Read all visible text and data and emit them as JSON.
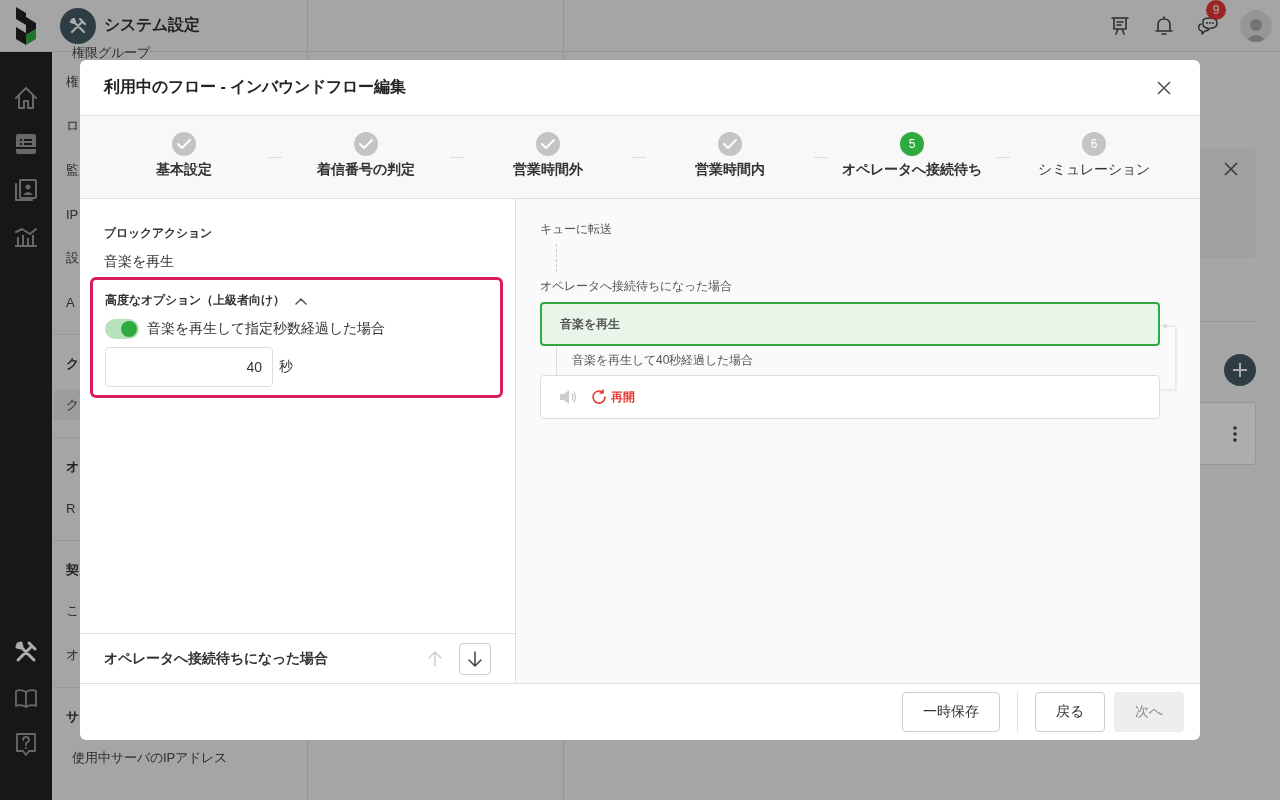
{
  "app": {
    "title": "システム設定"
  },
  "header_icons": [
    {
      "kind": "board"
    },
    {
      "kind": "bell"
    },
    {
      "kind": "chat",
      "badge": "9"
    }
  ],
  "rail": [
    {
      "kind": "home",
      "selected": false
    },
    {
      "kind": "list",
      "selected": false
    },
    {
      "kind": "contact",
      "selected": false
    },
    {
      "kind": "chart",
      "selected": false
    },
    {
      "kind": "spacer"
    },
    {
      "kind": "tools",
      "selected": true
    },
    {
      "kind": "book",
      "selected": false
    },
    {
      "kind": "help",
      "selected": false
    }
  ],
  "settings_menu": [
    {
      "kind": "item",
      "label": "権限グループ",
      "selected": false
    },
    {
      "kind": "item",
      "label": "権",
      "selected": false
    },
    {
      "kind": "item",
      "label": "ロ",
      "selected": false
    },
    {
      "kind": "item",
      "label": "監",
      "selected": false
    },
    {
      "kind": "item",
      "label": "IP",
      "selected": false
    },
    {
      "kind": "item",
      "label": "設",
      "selected": false
    },
    {
      "kind": "item",
      "label": "A",
      "selected": false
    },
    {
      "kind": "header",
      "label": "ク"
    },
    {
      "kind": "item",
      "label": "ク",
      "selected": true
    },
    {
      "kind": "header",
      "label": "オ"
    },
    {
      "kind": "item",
      "label": "R",
      "selected": false
    },
    {
      "kind": "header",
      "label": "契"
    },
    {
      "kind": "item",
      "label": "こ",
      "selected": false
    },
    {
      "kind": "item",
      "label": "オ",
      "selected": false
    },
    {
      "kind": "header",
      "label": "サ"
    },
    {
      "kind": "item",
      "label": "使用中サーバのIPアドレス",
      "selected": false
    }
  ],
  "dialog": {
    "title": "利用中のフロー - インバウンドフロー編集",
    "steps": [
      {
        "label": "基本設定",
        "completed": true,
        "selected": false
      },
      {
        "label": "着信番号の判定",
        "completed": true,
        "selected": false
      },
      {
        "label": "営業時間外",
        "completed": true,
        "selected": false
      },
      {
        "label": "営業時間内",
        "completed": true,
        "selected": false
      },
      {
        "label": "オペレータへ接続待ち",
        "completed": false,
        "selected": true,
        "number": "5"
      },
      {
        "label": "シミュレーション",
        "completed": false,
        "selected": false,
        "number": "6"
      }
    ],
    "editor": {
      "section_label": "ブロックアクション",
      "action": "音楽を再生",
      "advanced": {
        "title": "高度なオプション（上級者向け）",
        "expanded": true,
        "highlighted": true,
        "toggle": {
          "label": "音楽を再生して指定秒数経過した場合",
          "on": true
        },
        "seconds": {
          "value": "40",
          "unit": "秒"
        }
      },
      "footer": {
        "label": "オペレータへ接続待ちになった場合",
        "up_disabled": true,
        "down_disabled": false
      }
    },
    "flow": {
      "previous": "キューに転送",
      "condition": "オペレータへ接続待ちになった場合",
      "block": {
        "label": "音楽を再生",
        "selected": true
      },
      "branch": "音楽を再生して40秒経過した場合",
      "next": {
        "action": "再開"
      }
    },
    "buttons": [
      {
        "label": "一時保存",
        "disabled": false
      },
      {
        "label": "戻る",
        "disabled": false
      },
      {
        "label": "次へ",
        "disabled": true
      }
    ]
  }
}
